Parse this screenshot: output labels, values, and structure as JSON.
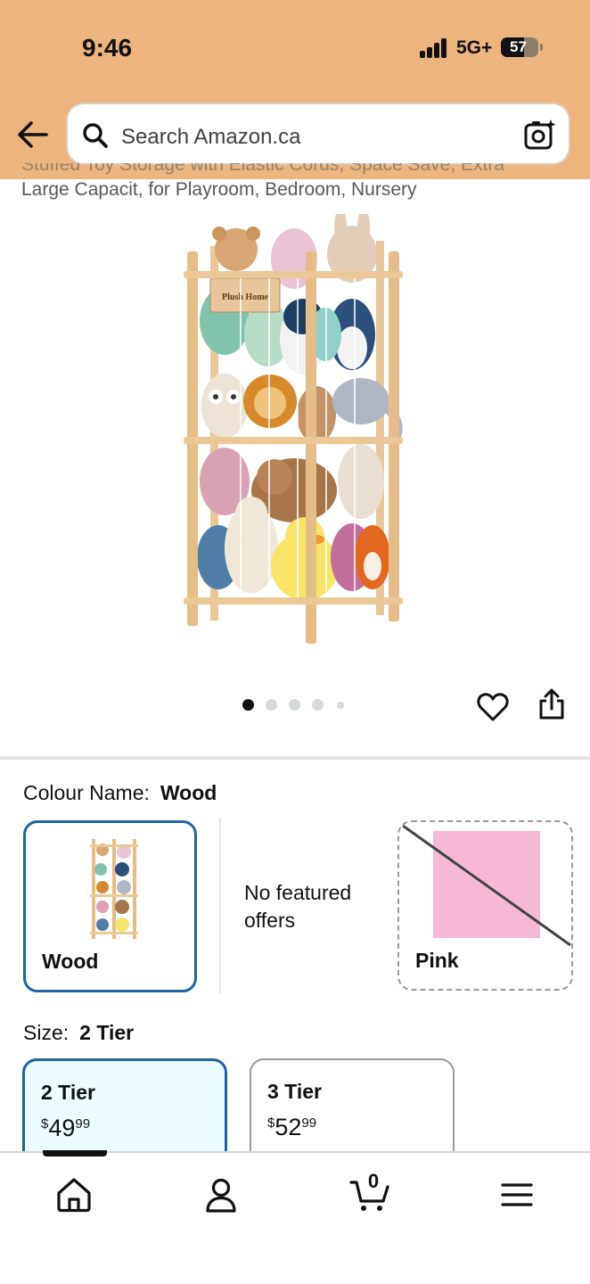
{
  "status_bar": {
    "time": "9:46",
    "network": "5G+",
    "battery": "57",
    "signal_icon": "cellular-signal-icon",
    "battery_icon": "battery-icon"
  },
  "header": {
    "back_icon": "back-arrow-icon",
    "search_icon": "search-icon",
    "search_placeholder": "Search Amazon.ca",
    "camera_icon": "camera-search-icon",
    "band_color": "#edb57d"
  },
  "product": {
    "title_line_1_partial": "Stuffed Toy Storage with Elastic Cords, Space Save, Extra",
    "title_line_2": "Large Capacit, for Playroom, Bedroom, Nursery",
    "image_sign_text": "Plush Home",
    "image_dots_total": 5,
    "image_dot_active": 1,
    "favorite_icon": "heart-icon",
    "share_icon": "share-icon"
  },
  "colour": {
    "label": "Colour Name:",
    "selected": "Wood",
    "options": [
      {
        "name": "Wood",
        "state": "selected",
        "thumb": "product-thumbnail"
      },
      {
        "name": "Pink",
        "state": "unavailable",
        "swatch_color": "#f7b8d5"
      }
    ],
    "no_offers_text": "No featured offers"
  },
  "size": {
    "label": "Size:",
    "selected": "2 Tier",
    "options": [
      {
        "name": "2 Tier",
        "currency": "$",
        "whole": "49",
        "fraction": "99",
        "state": "selected"
      },
      {
        "name": "3 Tier",
        "currency": "$",
        "whole": "52",
        "fraction": "99",
        "state": "available"
      }
    ]
  },
  "tab_bar": {
    "tabs": [
      {
        "name": "home",
        "icon": "home-icon"
      },
      {
        "name": "account",
        "icon": "account-icon"
      },
      {
        "name": "cart",
        "icon": "cart-icon",
        "count": "0"
      },
      {
        "name": "menu",
        "icon": "menu-icon"
      }
    ]
  },
  "colors": {
    "selected_border": "#2162a1",
    "selected_fill": "#edfdff",
    "text": "#0f1111",
    "muted_text": "#565959"
  }
}
